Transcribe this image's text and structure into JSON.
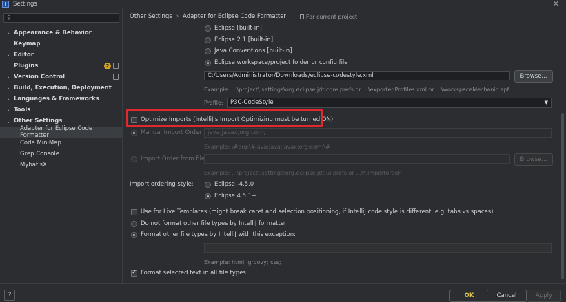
{
  "window": {
    "title": "Settings",
    "close_glyph": "✕",
    "logo_letter": "IJ"
  },
  "sidebar": {
    "search_placeholder": "",
    "items": [
      {
        "label": "Appearance & Behavior",
        "bold": true,
        "arrow": "›"
      },
      {
        "label": "Keymap",
        "bold": true,
        "arrow": ""
      },
      {
        "label": "Editor",
        "bold": true,
        "arrow": "›"
      },
      {
        "label": "Plugins",
        "bold": true,
        "arrow": "",
        "badge": "2"
      },
      {
        "label": "Version Control",
        "bold": true,
        "arrow": "›"
      },
      {
        "label": "Build, Execution, Deployment",
        "bold": true,
        "arrow": "›"
      },
      {
        "label": "Languages & Frameworks",
        "bold": true,
        "arrow": "›"
      },
      {
        "label": "Tools",
        "bold": true,
        "arrow": "›"
      },
      {
        "label": "Other Settings",
        "bold": true,
        "arrow": "⌄"
      },
      {
        "label": "Adapter for Eclipse Code Formatter",
        "bold": false,
        "selected": true
      },
      {
        "label": "Code MiniMap",
        "bold": false
      },
      {
        "label": "Grep Console",
        "bold": false
      },
      {
        "label": "MybatisX",
        "bold": false
      }
    ]
  },
  "breadcrumb": {
    "root": "Other Settings",
    "separator": "›",
    "current": "Adapter for Eclipse Code Formatter",
    "scope": "For current project"
  },
  "formatter": {
    "options": [
      "Eclipse [built-in]",
      "Eclipse 2.1 [built-in]",
      "Java Conventions [built-in]",
      "Eclipse workspace/project folder or config file"
    ],
    "config_path": "C:/Users/Administrator/Downloads/eclipse-codestyle.xml",
    "browse_label": "Browse...",
    "example_hint": "Example: ...\\project\\.settings\\org.eclipse.jdt.core.prefs or ...\\exportedProfiles.xml or ...\\workspaceMechanic.epf",
    "profile_label": "Profile:",
    "profile_value": "P3C-CodeStyle",
    "dropdown_glyph": "▼"
  },
  "imports": {
    "optimize_label": "Optimize Imports  (IntelliJ's Import Optimizing must be turned ON)",
    "manual_order_label": "Manual Import Order",
    "manual_order_value": "java;javax;org;com;",
    "manual_order_hint": "Example: \\#org;\\#java;java;javax;org;com;\\#",
    "import_order_file_label": "Import Order from file",
    "import_order_file_value": "",
    "import_order_browse": "Browse...",
    "import_order_hint": "Example: ...\\project\\.settings\\org.eclipse.jdt.ui.prefs or ...\\*.importorder",
    "ordering_style_label": "Import ordering style:",
    "ordering_options": [
      "Eclipse -4.5.0",
      "Eclipse 4.5.1+"
    ]
  },
  "misc": {
    "live_templates_label": "Use for Live Templates (might break caret and selection positioning, if IntelliJ code style is different, e.g. tabs vs spaces)",
    "do_not_format_label": "Do not format other file types by IntelliJ formatter",
    "format_other_label": "Format other file types by IntelliJ with this exception:",
    "exception_value": "",
    "exception_hint": "Example: html; groovy; css;",
    "format_selected_label": "Format selected text in all file types"
  },
  "footer": {
    "help": "?",
    "ok": "OK",
    "cancel": "Cancel",
    "apply": "Apply"
  },
  "colors": {
    "accent_ok": "#e0c44a",
    "highlight_border": "#e0282d",
    "badge": "#d4a21b"
  }
}
